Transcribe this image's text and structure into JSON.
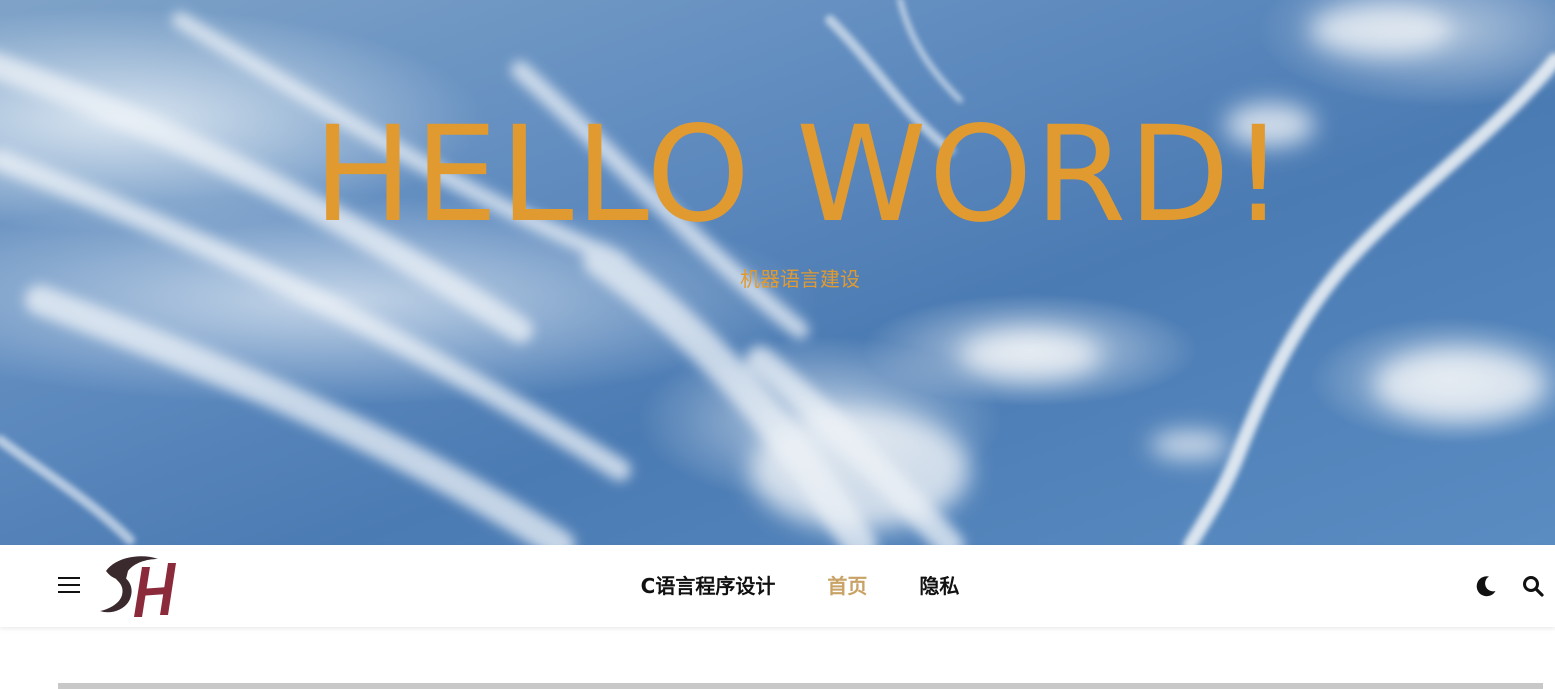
{
  "hero": {
    "title": "HELLO WORD!",
    "subtitle": "机器语言建设"
  },
  "navbar": {
    "menu_icon": "menu-icon",
    "logo_icon": "site-logo",
    "links": [
      {
        "label": "C语言程序设计",
        "active": false
      },
      {
        "label": "首页",
        "active": true
      },
      {
        "label": "隐私",
        "active": false
      }
    ],
    "dark_mode_icon": "moon-icon",
    "search_icon": "search-icon"
  },
  "colors": {
    "hero_text": "#e09a30",
    "nav_active": "#c9a265",
    "nav_text": "#111111",
    "sky": "#5f8bbf",
    "divider": "#c8c8c8",
    "logo_dark": "#3a2a2e",
    "logo_accent": "#8b2a3a"
  }
}
